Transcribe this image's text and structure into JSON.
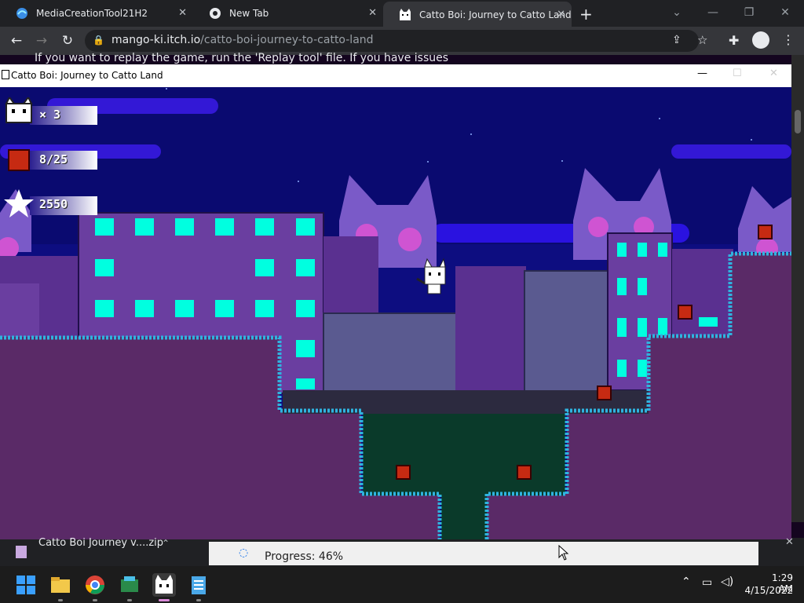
{
  "browser": {
    "tabs": [
      {
        "title": "MediaCreationTool21H2",
        "icon": "edge-icon"
      },
      {
        "title": "New Tab",
        "icon": "chrome-icon"
      },
      {
        "title": "Catto Boi: Journey to Catto Land",
        "icon": "catto-icon",
        "active": true
      }
    ],
    "url_host": "mango-ki.itch.io",
    "url_path": "/catto-boi-journey-to-catto-land",
    "page_text": "If you want to replay the game, run the 'Replay tool' file. If you have issues"
  },
  "game_window": {
    "title": "Catto Boi: Journey to Catto Land",
    "hud": {
      "lives": "× 3",
      "boxes": "8/25",
      "score": "2550"
    }
  },
  "download": {
    "filename": "Catto Boi Journey v....zip",
    "progress_label": "Progress: 46%",
    "progress_value": 0.46
  },
  "taskbar": {
    "time": "1:29 AM",
    "date": "4/15/2022"
  },
  "colors": {
    "sky": "#0d0d80",
    "ground": "#5a2a67",
    "grass": "#2fb4e0",
    "building": "#6a3ea0",
    "window": "#00ffe0",
    "cave": "#0a3a2a"
  }
}
